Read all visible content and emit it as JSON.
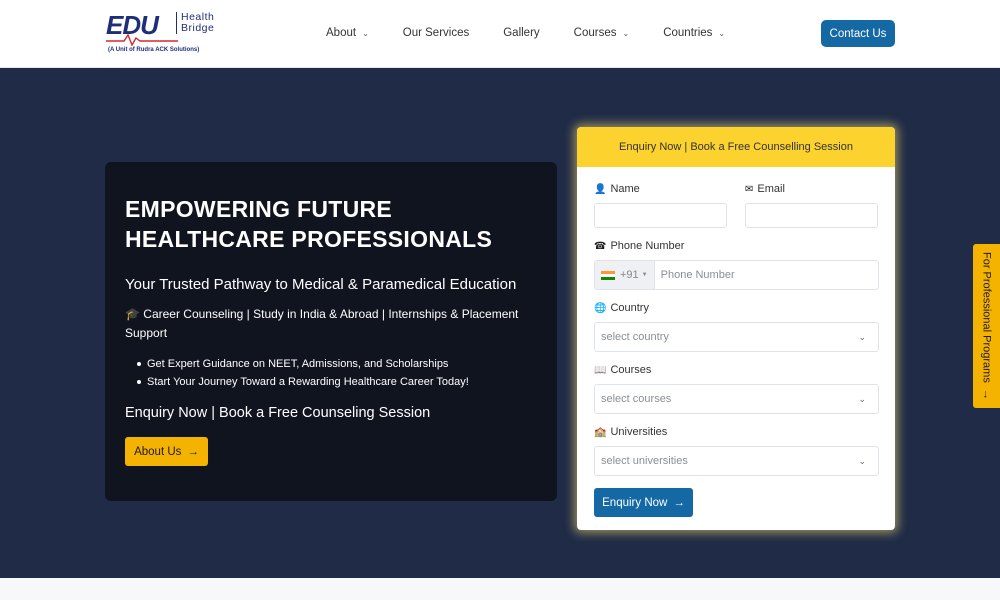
{
  "logo": {
    "brand": "EDU",
    "line1": "Health",
    "line2": "Bridge",
    "subtitle": "(A Unit of Rudra ACK Solutions)"
  },
  "nav": {
    "items": [
      {
        "label": "About",
        "has_dropdown": true
      },
      {
        "label": "Our Services",
        "has_dropdown": false
      },
      {
        "label": "Gallery",
        "has_dropdown": false
      },
      {
        "label": "Courses",
        "has_dropdown": true
      },
      {
        "label": "Countries",
        "has_dropdown": true
      }
    ],
    "contact_label": "Contact Us"
  },
  "hero": {
    "title": "EMPOWERING FUTURE HEALTHCARE PROFESSIONALS",
    "subtitle": "Your Trusted Pathway to Medical & Paramedical Education",
    "tags": "🎓 Career Counseling | Study in India & Abroad | Internships & Placement Support",
    "bullets": [
      "Get Expert Guidance on NEET, Admissions, and Scholarships",
      "Start Your Journey Toward a Rewarding Healthcare Career Today!"
    ],
    "cta_text": "Enquiry Now | Book a Free Counseling Session",
    "about_button": "About Us"
  },
  "form": {
    "header": "Enquiry Now | Book a Free Counselling Session",
    "name_label": "Name",
    "email_label": "Email",
    "phone_label": "Phone Number",
    "phone_code": "+91",
    "phone_placeholder": "Phone Number",
    "country_label": "Country",
    "country_value": "select country",
    "courses_label": "Courses",
    "courses_value": "select courses",
    "universities_label": "Universities",
    "universities_value": "select universities",
    "submit_label": "Enquiry Now"
  },
  "side_tab": {
    "label": "For Professional Programs"
  },
  "colors": {
    "primary_blue": "#1468a4",
    "hero_bg": "#1f2b47",
    "accent_yellow": "#f5b301",
    "form_header": "#fcd22e"
  }
}
